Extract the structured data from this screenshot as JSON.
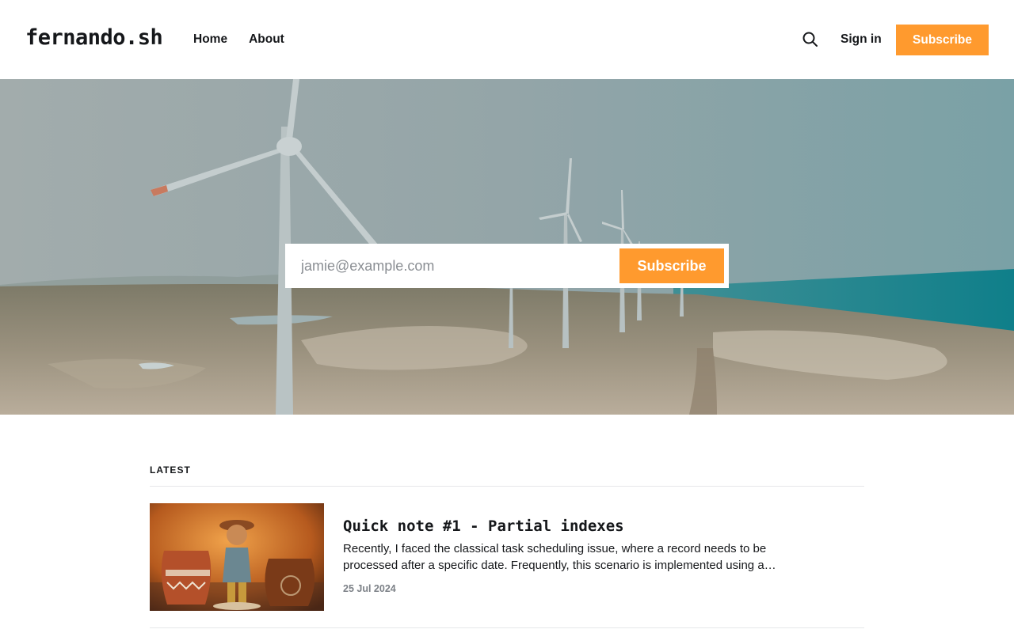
{
  "site": {
    "logo": "fernando.sh"
  },
  "nav": {
    "items": [
      {
        "label": "Home"
      },
      {
        "label": "About"
      }
    ]
  },
  "header": {
    "signin_label": "Sign in",
    "subscribe_label": "Subscribe",
    "accent": "#ff9a2e"
  },
  "hero": {
    "email_placeholder": "jamie@example.com",
    "subscribe_label": "Subscribe"
  },
  "latest": {
    "label": "LATEST",
    "posts": [
      {
        "title": "Quick note #1 - Partial indexes",
        "excerpt": "Recently, I faced the classical task scheduling issue, where a record needs to be processed after a specific date. Frequently, this scenario is implemented using a…",
        "date": "25 Jul 2024"
      }
    ]
  },
  "icons": {
    "search": "search-icon"
  }
}
